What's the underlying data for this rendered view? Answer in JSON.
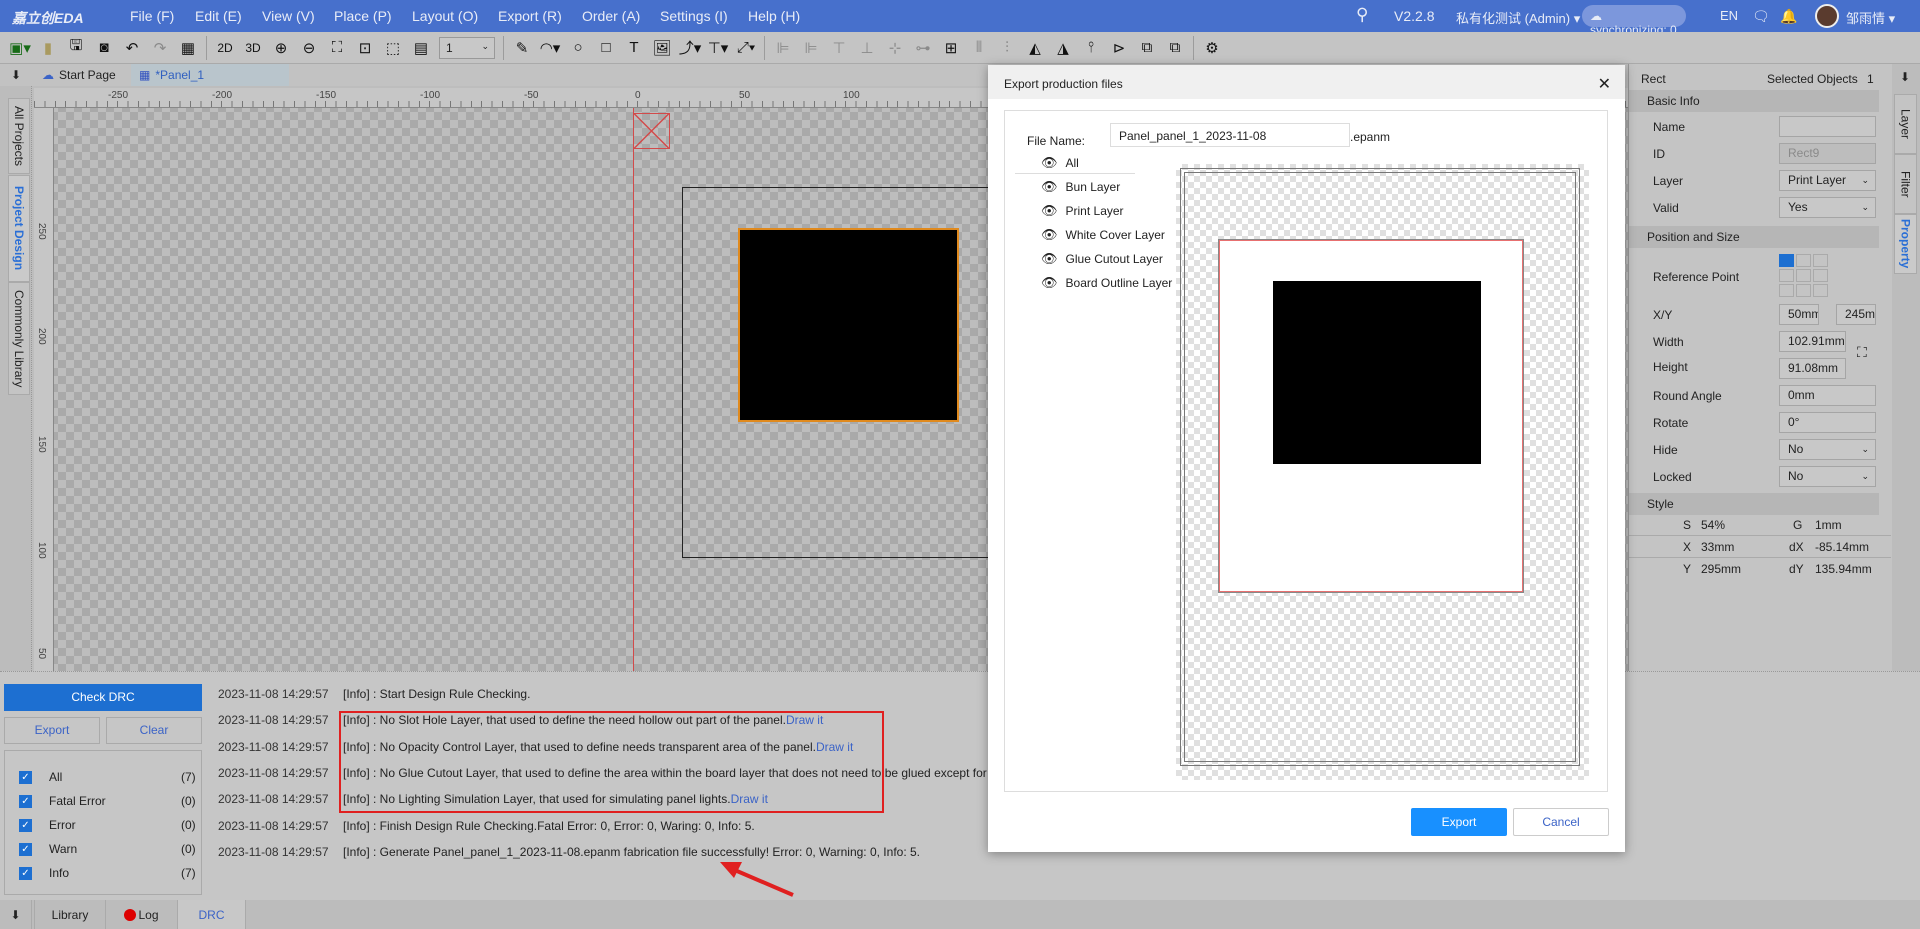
{
  "topbar": {
    "logo": "嘉立创EDA",
    "menus": [
      "File (F)",
      "Edit (E)",
      "View (V)",
      "Place (P)",
      "Layout (O)",
      "Export (R)",
      "Order (A)",
      "Settings (I)",
      "Help (H)"
    ],
    "version": "V2.2.8",
    "workspace": "私有化测试 (Admin)",
    "sync": "synchronizing: 0",
    "lang": "EN",
    "user": "邹雨情"
  },
  "toolbar": {
    "line_width": "1",
    "view_2d": "2D",
    "view_3d": "3D"
  },
  "tabs": [
    {
      "label": "Start Page"
    },
    {
      "label": "*Panel_1"
    }
  ],
  "left_tabs": [
    "All Projects",
    "Project Design",
    "Commonly Library"
  ],
  "ruler": {
    "h": [
      "-250",
      "-200",
      "-150",
      "-100",
      "-50",
      "0",
      "50",
      "100"
    ],
    "v": [
      "250",
      "200",
      "150",
      "100",
      "50"
    ]
  },
  "properties": {
    "type": "Rect",
    "selected_label": "Selected Objects",
    "selected_count": "1",
    "basic_info": "Basic Info",
    "name_label": "Name",
    "name_value": "",
    "id_label": "ID",
    "id_value": "Rect9",
    "layer_label": "Layer",
    "layer_value": "Print Layer",
    "valid_label": "Valid",
    "valid_value": "Yes",
    "pos_size": "Position and Size",
    "ref_label": "Reference Point",
    "xy_label": "X/Y",
    "x_value": "50mm",
    "y_value": "245mm",
    "width_label": "Width",
    "width_value": "102.91mm",
    "height_label": "Height",
    "height_value": "91.08mm",
    "round_label": "Round Angle",
    "round_value": "0mm",
    "rotate_label": "Rotate",
    "rotate_value": "0°",
    "hide_label": "Hide",
    "hide_value": "No",
    "locked_label": "Locked",
    "locked_value": "No",
    "style": "Style",
    "status": [
      [
        "S",
        "54%",
        "G",
        "1mm"
      ],
      [
        "X",
        "33mm",
        "dX",
        "-85.14mm"
      ],
      [
        "Y",
        "295mm",
        "dY",
        "135.94mm"
      ]
    ]
  },
  "right_tabs": [
    "Layer",
    "Filter",
    "Property"
  ],
  "drc": {
    "check": "Check DRC",
    "export": "Export",
    "clear": "Clear",
    "filters": [
      {
        "label": "All",
        "count": "(7)"
      },
      {
        "label": "Fatal Error",
        "count": "(0)"
      },
      {
        "label": "Error",
        "count": "(0)"
      },
      {
        "label": "Warn",
        "count": "(0)"
      },
      {
        "label": "Info",
        "count": "(7)"
      }
    ],
    "log": [
      {
        "ts": "2023-11-08 14:29:57",
        "msg": "[Info] : Start Design Rule Checking.",
        "link": ""
      },
      {
        "ts": "2023-11-08 14:29:57",
        "msg": "[Info] : No Slot Hole Layer, that used to define the need hollow out part of the panel.",
        "link": "Draw it"
      },
      {
        "ts": "2023-11-08 14:29:57",
        "msg": "[Info] : No Opacity Control Layer, that used to define needs transparent area of the panel.",
        "link": "Draw it"
      },
      {
        "ts": "2023-11-08 14:29:57",
        "msg": "[Info] : No Glue Cutout Layer, that used to define the area within the board layer that does not need to be glued except for",
        "link": ""
      },
      {
        "ts": "2023-11-08 14:29:57",
        "msg": "[Info] : No Lighting Simulation Layer, that used for simulating panel lights.",
        "link": "Draw it"
      },
      {
        "ts": "2023-11-08 14:29:57",
        "msg": "[Info] : Finish Design Rule Checking.Fatal Error: 0, Error: 0, Waring: 0, Info: 5.",
        "link": ""
      },
      {
        "ts": "2023-11-08 14:29:57",
        "msg": "[Info] : Generate Panel_panel_1_2023-11-08.epanm fabrication file successfully! Error: 0, Warning: 0, Info: 5.",
        "link": ""
      }
    ]
  },
  "bottom_tabs": [
    "Library",
    "Log",
    "DRC"
  ],
  "dialog": {
    "title": "Export production files",
    "file_label": "File Name:",
    "file_value": "Panel_panel_1_2023-11-08",
    "ext": ".epanm",
    "layers": [
      "All",
      "Bun Layer",
      "Print Layer",
      "White Cover Layer",
      "Glue Cutout Layer",
      "Board Outline Layer"
    ],
    "export": "Export",
    "cancel": "Cancel"
  },
  "colors": {
    "accent": "#1890ff",
    "topbar": "#4770cc",
    "highlight_box": "#e02020",
    "selection": "#e08a1e"
  }
}
